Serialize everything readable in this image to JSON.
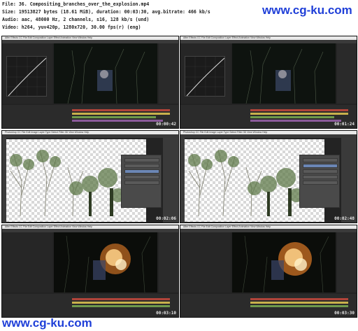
{
  "file_info": {
    "file": "File: 36. Compositing_branches_over_the_explosion.mp4",
    "size": "Size: 19513827 bytes (18.61 MiB), duration: 00:03:30, avg.bitrate: 466 kb/s",
    "audio": "Audio: aac, 48000 Hz, 2 channels, s16, 128 kb/s (und)",
    "video": "Video: h264, yuv420p, 1280x720, 30.00 fps(r) (eng)"
  },
  "watermark": "www.cg-ku.com",
  "thumbnails": [
    {
      "app": "After Effects",
      "timecode": "00:00:42"
    },
    {
      "app": "After Effects",
      "timecode": "00:01:24"
    },
    {
      "app": "Photoshop",
      "timecode": "00:02:06"
    },
    {
      "app": "Photoshop",
      "timecode": "00:02:48"
    },
    {
      "app": "After Effects",
      "timecode": "00:03:10"
    },
    {
      "app": "After Effects",
      "timecode": "00:03:30"
    }
  ],
  "menus": {
    "after_effects": "After Effects CC  File  Edit  Composition  Layer  Effect  Animation  View  Window  Help",
    "photoshop": "Photoshop CC  File  Edit  Image  Layer  Type  Select  Filter  3D  View  Window  Help"
  },
  "colors": {
    "watermark": "#1f3fd8",
    "ae_bg": "#232323",
    "timeline_red": "#b0443a",
    "timeline_green": "#6f9a4b",
    "timeline_yellow": "#c9b04c",
    "ps_layer_selected": "#6b86b5",
    "explosion": "#ffb347"
  }
}
